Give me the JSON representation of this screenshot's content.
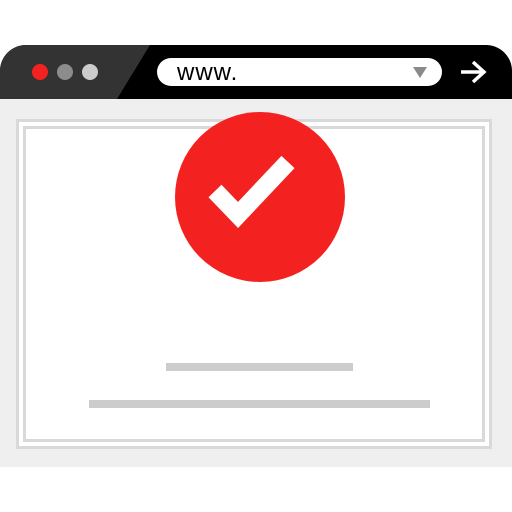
{
  "browser": {
    "window_controls": [
      {
        "name": "close",
        "color": "#f42121"
      },
      {
        "name": "minimize",
        "color": "#8c8c8c"
      },
      {
        "name": "maximize",
        "color": "#cccccc"
      }
    ],
    "address_bar": {
      "value": "www.",
      "dropdown_icon": "triangle-down-icon"
    },
    "go_button": {
      "icon": "arrow-right-icon"
    }
  },
  "content": {
    "status_icon": "checkmark-icon",
    "status_color": "#f42121",
    "placeholder_lines": 2
  },
  "colors": {
    "titlebar": "#000000",
    "titlebar_accent": "#333333",
    "viewport_bg": "#efefef",
    "placeholder_line": "#cccccc"
  }
}
